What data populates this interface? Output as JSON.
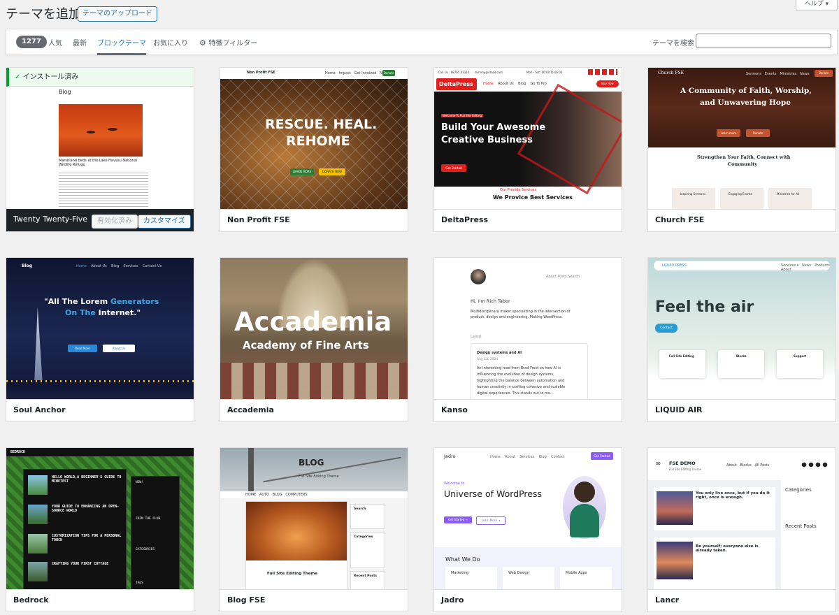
{
  "header": {
    "title": "テーマを追加",
    "upload_label": "テーマのアップロード",
    "help_label": "ヘルプ ▾"
  },
  "filter": {
    "count": "1277",
    "tabs": [
      "人気",
      "最新",
      "ブロックテーマ",
      "お気に入り"
    ],
    "active_tab": "ブロックテーマ",
    "feature_filter_label": "特徴フィルター",
    "search_label": "テーマを検索",
    "search_value": ""
  },
  "installed_notice": "インストール済み",
  "actions": {
    "activated_label": "有効化済み",
    "customize_label": "カスタマイズ"
  },
  "themes": [
    {
      "name": "Twenty Twenty-Five"
    },
    {
      "name": "Non Profit FSE"
    },
    {
      "name": "DeltaPress"
    },
    {
      "name": "Church FSE"
    },
    {
      "name": "Soul Anchor"
    },
    {
      "name": "Accademia"
    },
    {
      "name": "Kanso"
    },
    {
      "name": "LIQUID AIR"
    },
    {
      "name": "Bedrock"
    },
    {
      "name": "Blog FSE"
    },
    {
      "name": "Jadro"
    },
    {
      "name": "Lancr"
    }
  ],
  "previews": {
    "tt5": {
      "heading": "Blog",
      "caption": "Marshland birds at the Lake Havasu National Wildlife Refuge"
    },
    "nonprofit": {
      "brand": "Non Profit FSE",
      "headline1": "RESCUE. HEAL.",
      "headline2": "REHOME",
      "btn1": "LEARN MORE",
      "btn2": "DONATE NOW",
      "nav_btn": "Donate"
    },
    "delta": {
      "logo": "DeltaPress",
      "phone": "Call Us : 98765 43210",
      "email": "dummy@email.com",
      "hours": "Mon - Sat: 06:00 To 06:00",
      "kicker": "Welcome To Full Site Editing",
      "headline1": "Build Your Awesome",
      "headline2": "Creative Business",
      "cta": "Get Started",
      "services_kicker": "Our Provide Services",
      "services_title": "We Provice Best Services",
      "buy": "Buy Now"
    },
    "church": {
      "brand": "Church FSE",
      "headline1": "A Community of Faith, Worship,",
      "headline2": "and Unwavering Hope",
      "btn1": "Learn more",
      "btn2": "Donate",
      "sub1": "Strengthen Your Faith, Connect with",
      "sub2": "Community",
      "col1": "Inspiring Sermons",
      "col2": "Engaging Events",
      "col3": "Ministries for All",
      "nav_btn": "Donate"
    },
    "soul": {
      "brand": "Blog",
      "headline1a": "\"All The Lorem ",
      "headline1b": "Generators",
      "headline2a": "On The ",
      "headline2b": "Internet.\"",
      "btn1": "Read More",
      "btn2": "About Us"
    },
    "accademia": {
      "title": "Accademia",
      "subtitle": "Academy of Fine Arts"
    },
    "kanso": {
      "greeting": "Hi, I'm Rich Tabor",
      "bio1": "Multidisciplinary maker specializing in the intersection of",
      "bio2": "product, design and engineering. Making WordPress.",
      "latest": "Latest",
      "post_title": "Design systems and AI",
      "post_date": "Aug 13, 2024",
      "post_l1": "An interesting read from Brad Frost on how AI is",
      "post_l2": "influencing the evolution of design systems,",
      "post_l3": "highlighting the balance between automation and",
      "post_l4": "human creativity in crafting cohesive and scalable",
      "post_l5": "digital experiences. This stands out to me...",
      "nav": "About   Posts   Search"
    },
    "liquid": {
      "brand": "LIQUID PRESS",
      "headline": "Feel the air",
      "btn": "Contact",
      "c1": "Full Site Editing",
      "c2": "Blocks",
      "c3": "Support"
    },
    "bedrock": {
      "brand": "BEDROCK",
      "p1": "HELLO WORLD,A BEGINNER'S GUIDE TO MINETEST",
      "p2": "YOUR GUIDE TO ENHANCING AN OPEN-SOURCE WORLD",
      "p3": "CUSTOMIZATION TIPS FOR A PERSONAL TOUCH",
      "p4": "CRAFTING YOUR FIRST COTTAGE",
      "s1": "NEW!",
      "s2": "JOIN THE CLUB",
      "s3": "CATEGORIES",
      "s4": "TAGS"
    },
    "blogfse": {
      "logo": "BLOG",
      "tagline": "Full Site Editing Theme",
      "post_title": "Full Site Editing Theme",
      "w1": "Search",
      "w2": "Categories",
      "w3": "Recent Posts"
    },
    "jadro": {
      "brand": "Jadro",
      "kicker": "Welcome to",
      "headline": "Universe of WordPress",
      "btn1": "Get Started →",
      "btn2": "Learn More →",
      "section": "What We Do",
      "c1": "Marketing",
      "c2": "Web Design",
      "c3": "Mobile Apps",
      "nav_btn": "Get Started"
    },
    "lancr": {
      "brand": "FSE DEMO",
      "tagline": "Full Site Editing Theme",
      "p1": "You only live once, but if you do it right, once is enough.",
      "p2": "Be yourself; everyone else is already taken.",
      "side1": "Categories",
      "side2": "Recent Posts"
    }
  },
  "colors": {
    "accent": "#2271b1",
    "success": "#00a32a",
    "dark": "#1d2327"
  }
}
